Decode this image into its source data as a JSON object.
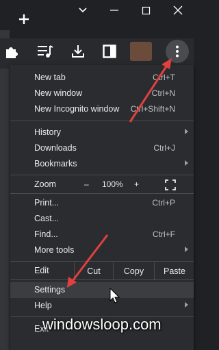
{
  "menu": {
    "new_tab": {
      "label": "New tab",
      "shortcut": "Ctrl+T"
    },
    "new_window": {
      "label": "New window",
      "shortcut": "Ctrl+N"
    },
    "new_incognito": {
      "label": "New Incognito window",
      "shortcut": "Ctrl+Shift+N"
    },
    "history": {
      "label": "History"
    },
    "downloads": {
      "label": "Downloads",
      "shortcut": "Ctrl+J"
    },
    "bookmarks": {
      "label": "Bookmarks"
    },
    "zoom": {
      "label": "Zoom",
      "minus": "–",
      "level": "100%",
      "plus": "+"
    },
    "print": {
      "label": "Print...",
      "shortcut": "Ctrl+P"
    },
    "cast": {
      "label": "Cast..."
    },
    "find": {
      "label": "Find...",
      "shortcut": "Ctrl+F"
    },
    "more_tools": {
      "label": "More tools"
    },
    "edit": {
      "label": "Edit",
      "cut": "Cut",
      "copy": "Copy",
      "paste": "Paste"
    },
    "settings": {
      "label": "Settings"
    },
    "help": {
      "label": "Help"
    },
    "exit": {
      "label": "Exit"
    }
  },
  "watermark": "windowsloop.com",
  "annotation_color": "#e0413f",
  "icons": [
    "plus-icon",
    "minimize-icon",
    "maximize-icon",
    "close-icon",
    "puzzle-icon",
    "media-queue-icon",
    "download-icon",
    "side-panel-icon",
    "kebab-menu-icon",
    "fullscreen-icon",
    "mouse-cursor-icon"
  ]
}
